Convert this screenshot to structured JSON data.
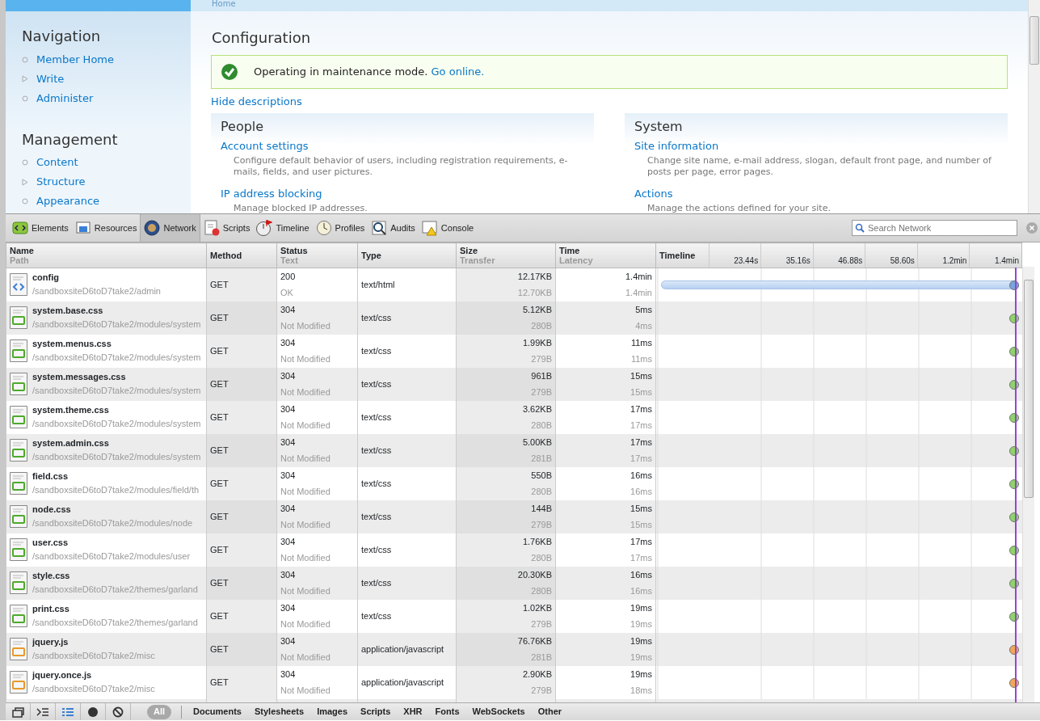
{
  "page": {
    "breadcrumb": "Home",
    "sidebar": [
      {
        "title": "Navigation",
        "items": [
          {
            "label": "Member Home",
            "expandable": false
          },
          {
            "label": "Write",
            "expandable": true
          },
          {
            "label": "Administer",
            "expandable": false
          }
        ]
      },
      {
        "title": "Management",
        "items": [
          {
            "label": "Content",
            "expandable": false
          },
          {
            "label": "Structure",
            "expandable": true
          },
          {
            "label": "Appearance",
            "expandable": false
          }
        ]
      }
    ],
    "title": "Configuration",
    "message": {
      "text": "Operating in maintenance mode.",
      "link": "Go online."
    },
    "toggle_link": "Hide descriptions",
    "panels": [
      {
        "title": "People",
        "entries": [
          {
            "link": "Account settings",
            "description": "Configure default behavior of users, including registration requirements, e-mails, fields, and user pictures."
          },
          {
            "link": "IP address blocking",
            "description": "Manage blocked IP addresses."
          }
        ]
      },
      {
        "title": "System",
        "entries": [
          {
            "link": "Site information",
            "description": "Change site name, e-mail address, slogan, default front page, and number of posts per page, error pages."
          },
          {
            "link": "Actions",
            "description": "Manage the actions defined for your site."
          }
        ]
      }
    ]
  },
  "devtools": {
    "tabs": [
      {
        "label": "Elements",
        "selected": false
      },
      {
        "label": "Resources",
        "selected": false
      },
      {
        "label": "Network",
        "selected": true
      },
      {
        "label": "Scripts",
        "selected": false
      },
      {
        "label": "Timeline",
        "selected": false
      },
      {
        "label": "Profiles",
        "selected": false
      },
      {
        "label": "Audits",
        "selected": false
      },
      {
        "label": "Console",
        "selected": false
      }
    ],
    "search": {
      "placeholder": "Search Network"
    },
    "columns": [
      {
        "title": "Name",
        "subtitle": "Path"
      },
      {
        "title": "Method"
      },
      {
        "title": "Status",
        "subtitle": "Text"
      },
      {
        "title": "Type"
      },
      {
        "title": "Size",
        "subtitle": "Transfer"
      },
      {
        "title": "Time",
        "subtitle": "Latency"
      },
      {
        "title": "Timeline"
      }
    ],
    "timeline_ticks": [
      "23.44s",
      "35.16s",
      "46.88s",
      "58.60s",
      "1.2min",
      "1.4min"
    ],
    "rows": [
      {
        "kind": "html",
        "name": "config",
        "path": "/sandboxsiteD6toD7take2/admin",
        "method": "GET",
        "status": "200",
        "status_text": "OK",
        "type": "text/html",
        "size": "12.17KB",
        "transfer": "12.70KB",
        "time": "1.4min",
        "latency": "1.4min",
        "long_bar": true
      },
      {
        "kind": "css",
        "name": "system.base.css",
        "path": "/sandboxsiteD6toD7take2/modules/system",
        "method": "GET",
        "status": "304",
        "status_text": "Not Modified",
        "type": "text/css",
        "size": "5.12KB",
        "transfer": "280B",
        "time": "5ms",
        "latency": "4ms",
        "long_bar": false
      },
      {
        "kind": "css",
        "name": "system.menus.css",
        "path": "/sandboxsiteD6toD7take2/modules/system",
        "method": "GET",
        "status": "304",
        "status_text": "Not Modified",
        "type": "text/css",
        "size": "1.99KB",
        "transfer": "279B",
        "time": "11ms",
        "latency": "11ms",
        "long_bar": false
      },
      {
        "kind": "css",
        "name": "system.messages.css",
        "path": "/sandboxsiteD6toD7take2/modules/system",
        "method": "GET",
        "status": "304",
        "status_text": "Not Modified",
        "type": "text/css",
        "size": "961B",
        "transfer": "279B",
        "time": "15ms",
        "latency": "15ms",
        "long_bar": false
      },
      {
        "kind": "css",
        "name": "system.theme.css",
        "path": "/sandboxsiteD6toD7take2/modules/system",
        "method": "GET",
        "status": "304",
        "status_text": "Not Modified",
        "type": "text/css",
        "size": "3.62KB",
        "transfer": "280B",
        "time": "17ms",
        "latency": "17ms",
        "long_bar": false
      },
      {
        "kind": "css",
        "name": "system.admin.css",
        "path": "/sandboxsiteD6toD7take2/modules/system",
        "method": "GET",
        "status": "304",
        "status_text": "Not Modified",
        "type": "text/css",
        "size": "5.00KB",
        "transfer": "281B",
        "time": "17ms",
        "latency": "17ms",
        "long_bar": false
      },
      {
        "kind": "css",
        "name": "field.css",
        "path": "/sandboxsiteD6toD7take2/modules/field/th",
        "method": "GET",
        "status": "304",
        "status_text": "Not Modified",
        "type": "text/css",
        "size": "550B",
        "transfer": "280B",
        "time": "16ms",
        "latency": "16ms",
        "long_bar": false
      },
      {
        "kind": "css",
        "name": "node.css",
        "path": "/sandboxsiteD6toD7take2/modules/node",
        "method": "GET",
        "status": "304",
        "status_text": "Not Modified",
        "type": "text/css",
        "size": "144B",
        "transfer": "279B",
        "time": "15ms",
        "latency": "15ms",
        "long_bar": false
      },
      {
        "kind": "css",
        "name": "user.css",
        "path": "/sandboxsiteD6toD7take2/modules/user",
        "method": "GET",
        "status": "304",
        "status_text": "Not Modified",
        "type": "text/css",
        "size": "1.76KB",
        "transfer": "280B",
        "time": "17ms",
        "latency": "17ms",
        "long_bar": false
      },
      {
        "kind": "css",
        "name": "style.css",
        "path": "/sandboxsiteD6toD7take2/themes/garland",
        "method": "GET",
        "status": "304",
        "status_text": "Not Modified",
        "type": "text/css",
        "size": "20.30KB",
        "transfer": "280B",
        "time": "16ms",
        "latency": "16ms",
        "long_bar": false
      },
      {
        "kind": "css",
        "name": "print.css",
        "path": "/sandboxsiteD6toD7take2/themes/garland",
        "method": "GET",
        "status": "304",
        "status_text": "Not Modified",
        "type": "text/css",
        "size": "1.02KB",
        "transfer": "279B",
        "time": "19ms",
        "latency": "19ms",
        "long_bar": false
      },
      {
        "kind": "js",
        "name": "jquery.js",
        "path": "/sandboxsiteD6toD7take2/misc",
        "method": "GET",
        "status": "304",
        "status_text": "Not Modified",
        "type": "application/javascript",
        "size": "76.76KB",
        "transfer": "281B",
        "time": "19ms",
        "latency": "19ms",
        "long_bar": false
      },
      {
        "kind": "js",
        "name": "jquery.once.js",
        "path": "/sandboxsiteD6toD7take2/misc",
        "method": "GET",
        "status": "304",
        "status_text": "Not Modified",
        "type": "application/javascript",
        "size": "2.90KB",
        "transfer": "279B",
        "time": "19ms",
        "latency": "18ms",
        "long_bar": false
      }
    ],
    "filters": [
      {
        "label": "All",
        "selected": true
      },
      {
        "label": "Documents",
        "selected": false
      },
      {
        "label": "Stylesheets",
        "selected": false
      },
      {
        "label": "Images",
        "selected": false
      },
      {
        "label": "Scripts",
        "selected": false
      },
      {
        "label": "XHR",
        "selected": false
      },
      {
        "label": "Fonts",
        "selected": false
      },
      {
        "label": "WebSockets",
        "selected": false
      },
      {
        "label": "Other",
        "selected": false
      }
    ]
  }
}
